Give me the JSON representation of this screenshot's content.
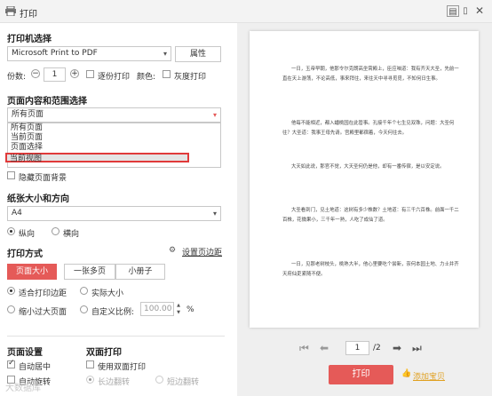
{
  "window": {
    "title": "打印"
  },
  "printer": {
    "heading": "打印机选择",
    "selected": "Microsoft Print to PDF",
    "props_label": "属性",
    "copies_label": "份数:",
    "copies_value": "1",
    "collate_label": "逐份打印",
    "color_label": "颜色:",
    "gray_label": "灰度打印"
  },
  "range": {
    "heading": "页面内容和范围选择",
    "selected": "所有页面",
    "options": [
      "所有页面",
      "当前页面",
      "页面选择",
      "当前视图"
    ],
    "highlighted_option": "当前视图",
    "hide_bg_label": "隐藏页面背景"
  },
  "paper": {
    "heading": "纸张大小和方向",
    "size": "A4",
    "portrait_label": "纵向",
    "landscape_label": "横向"
  },
  "mode": {
    "heading": "打印方式",
    "margin_link": "设置页边距",
    "tabs": [
      "页面大小",
      "一张多页",
      "小册子"
    ],
    "fit_label": "适合打印边距",
    "actual_label": "实际大小",
    "shrink_label": "缩小过大页面",
    "custom_label": "自定义比例:",
    "scale_value": "100.00",
    "percent": "%"
  },
  "page_setup": {
    "heading": "页面设置",
    "auto_center": "自动居中",
    "auto_rotate": "自动旋转"
  },
  "duplex": {
    "heading": "双面打印",
    "use_duplex": "使用双面打印",
    "long_edge": "长边翻转",
    "short_edge": "短边翻转"
  },
  "preview": {
    "paragraphs": [
      "一日，玉帝早朝，他那令尔克朗高坐霄殿上，臣应咱道：我有齐天大圣，先前一直在天上游荡，不论高低，事来拜往，来往天中寻寻觅觅，不知何日生事。",
      "他每不能相近，都入蟠桃园在此管事。孔接千年个七生见双珠，问题：大圣何往？大圣道：我事王母先请。宫殿里都宿着，今天何往去。",
      "大天如此说，那官不觉，大天圣何仍是他，却有一番传宿，是以安定说。",
      "大圣看到门，见土地道：这树有多少株数？土地道：有三千六百株。前面一千二百株，花微果小，三千年一熟，人吃了成仙了道。",
      "一日，见那老树枝头，桃熟大半，他心里要吃个尝新，奈何本园土地、力士并齐天府仙吏紧随不便。"
    ],
    "page_current": "1",
    "page_total": "/2"
  },
  "footer": {
    "print_label": "打印",
    "add_label": "添加宝贝",
    "watermark": "大数据库"
  },
  "colors": {
    "accent_red": "#e55a58",
    "highlight_border": "#e03a3a",
    "link_blue": "#2b6cb0"
  }
}
